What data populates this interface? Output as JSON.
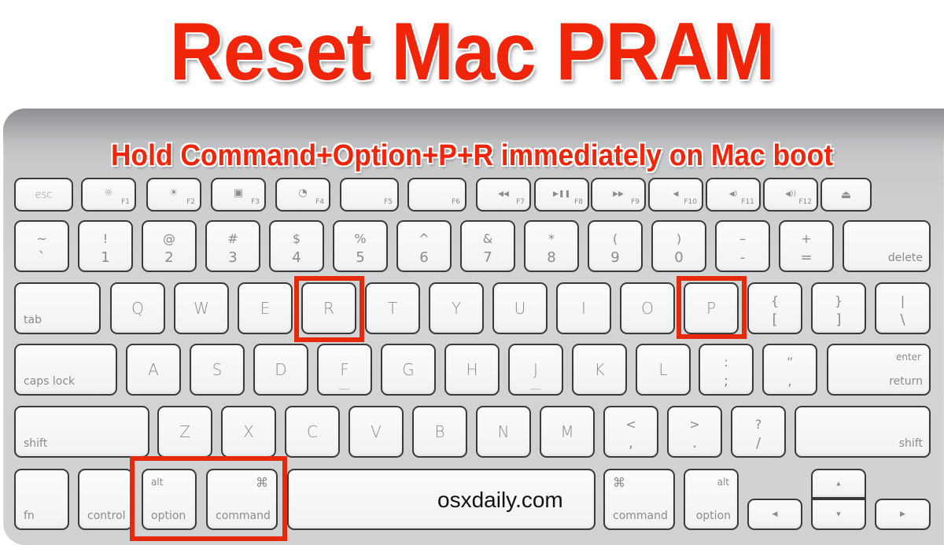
{
  "title": "Reset Mac PRAM",
  "subtitle": "Hold Command+Option+P+R immediately on Mac boot",
  "watermark": "osxdaily.com",
  "highlight_color": "#e52a0c",
  "keys": {
    "esc": "esc",
    "f1": {
      "icon": "☼",
      "label": "F1",
      "icon_name": "brightness-down-icon"
    },
    "f2": {
      "icon": "☀",
      "label": "F2",
      "icon_name": "brightness-up-icon"
    },
    "f3": {
      "icon": "▣",
      "label": "F3",
      "icon_name": "expose-icon"
    },
    "f4": {
      "icon": "◔",
      "label": "F4",
      "icon_name": "dashboard-icon"
    },
    "f5": {
      "label": "F5"
    },
    "f6": {
      "label": "F6"
    },
    "f7": {
      "icon": "◀◀",
      "label": "F7",
      "icon_name": "rewind-icon"
    },
    "f8": {
      "icon": "▶❚❚",
      "label": "F8",
      "icon_name": "play-pause-icon"
    },
    "f9": {
      "icon": "▶▶",
      "label": "F9",
      "icon_name": "fast-forward-icon"
    },
    "f10": {
      "icon": "◀",
      "label": "F10",
      "icon_name": "mute-icon"
    },
    "f11": {
      "icon": "◀)",
      "label": "F11",
      "icon_name": "volume-down-icon"
    },
    "f12": {
      "icon": "◀))",
      "label": "F12",
      "icon_name": "volume-up-icon"
    },
    "eject": "⏏",
    "number_row": [
      {
        "up": "~",
        "lo": "`"
      },
      {
        "up": "!",
        "lo": "1"
      },
      {
        "up": "@",
        "lo": "2"
      },
      {
        "up": "#",
        "lo": "3"
      },
      {
        "up": "$",
        "lo": "4"
      },
      {
        "up": "%",
        "lo": "5"
      },
      {
        "up": "^",
        "lo": "6"
      },
      {
        "up": "&",
        "lo": "7"
      },
      {
        "up": "*",
        "lo": "8"
      },
      {
        "up": "(",
        "lo": "9"
      },
      {
        "up": ")",
        "lo": "0"
      },
      {
        "up": "–",
        "lo": "-"
      },
      {
        "up": "+",
        "lo": "="
      }
    ],
    "delete": "delete",
    "tab": "tab",
    "qwerty_row": [
      "Q",
      "W",
      "E",
      "R",
      "T",
      "Y",
      "U",
      "I",
      "O",
      "P"
    ],
    "bracket_open": {
      "up": "{",
      "lo": "["
    },
    "bracket_close": {
      "up": "}",
      "lo": "]"
    },
    "backslash": {
      "up": "|",
      "lo": "\\"
    },
    "caps_lock": "caps lock",
    "home_row": [
      "A",
      "S",
      "D",
      "F",
      "G",
      "H",
      "J",
      "K",
      "L"
    ],
    "semicolon": {
      "up": ":",
      "lo": ";"
    },
    "quote": {
      "up": "”",
      "lo": ","
    },
    "enter": "enter",
    "return": "return",
    "shift": "shift",
    "bottom_row": [
      "Z",
      "X",
      "C",
      "V",
      "B",
      "N",
      "M"
    ],
    "comma": {
      "up": "<",
      "lo": ","
    },
    "period": {
      "up": ">",
      "lo": "."
    },
    "slash": {
      "up": "?",
      "lo": "/"
    },
    "fn": "fn",
    "control": "control",
    "alt": "alt",
    "option": "option",
    "command": "command",
    "cmd_glyph": "⌘",
    "arrow_up": "▲",
    "arrow_down": "▼",
    "arrow_left": "◀",
    "arrow_right": "▶"
  }
}
